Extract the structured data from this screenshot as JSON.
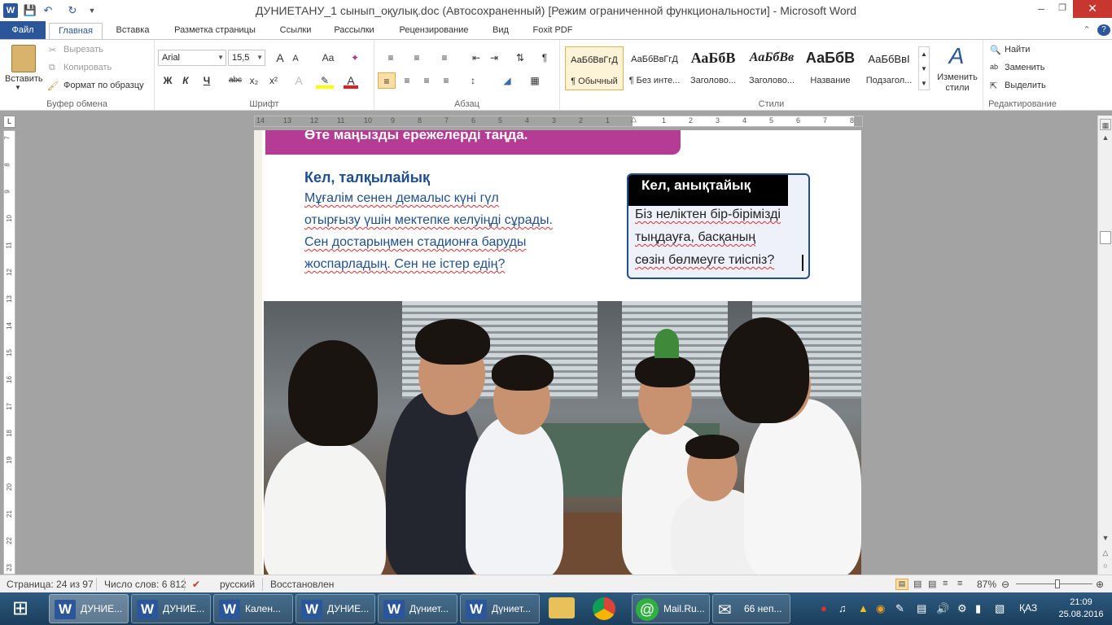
{
  "titlebar": {
    "title": "ДУНИЕТАНУ_1 сынып_оқулық.doc (Автосохраненный) [Режим ограниченной функциональности] - Microsoft Word",
    "help": "?"
  },
  "tabs": [
    "Файл",
    "Главная",
    "Вставка",
    "Разметка страницы",
    "Ссылки",
    "Рассылки",
    "Рецензирование",
    "Вид",
    "Foxit PDF"
  ],
  "ribbon": {
    "clipboard": {
      "paste": "Вставить",
      "cut": "Вырезать",
      "copy": "Копировать",
      "format_painter": "Формат по образцу",
      "label": "Буфер обмена"
    },
    "font": {
      "name": "Arial",
      "size": "15,5",
      "label": "Шрифт",
      "bold": "Ж",
      "italic": "К",
      "underline": "Ч",
      "strike": "abc",
      "sub": "x₂",
      "sup": "x²",
      "grow": "A",
      "shrink": "A",
      "case": "Aa"
    },
    "paragraph": {
      "label": "Абзац",
      "pilcrow": "¶"
    },
    "styles": {
      "label": "Стили",
      "items": [
        {
          "preview": "АаБбВвГгД",
          "name": "¶ Обычный"
        },
        {
          "preview": "АаБбВвГгД",
          "name": "¶ Без инте..."
        },
        {
          "preview": "АаБбВ",
          "name": "Заголово..."
        },
        {
          "preview": "АаБбВв",
          "name": "Заголово..."
        },
        {
          "preview": "АаБбВ",
          "name": "Название"
        },
        {
          "preview": "АаБбВвІ",
          "name": "Подзагол..."
        }
      ],
      "change": "Изменить стили"
    },
    "editing": {
      "label": "Редактирование",
      "find": "Найти",
      "replace": "Заменить",
      "select": "Выделить"
    }
  },
  "ruler": {
    "h_left": [
      "14",
      "13",
      "12",
      "11",
      "10",
      "9",
      "8",
      "7",
      "6",
      "5",
      "4",
      "3",
      "2",
      "1"
    ],
    "h_right": [
      "1",
      "2",
      "3",
      "4",
      "5",
      "6",
      "7",
      "8"
    ],
    "v": [
      "7",
      "8",
      "9",
      "10",
      "11",
      "12",
      "13",
      "14",
      "15",
      "16",
      "17",
      "18",
      "19",
      "20",
      "21",
      "22",
      "23"
    ]
  },
  "document": {
    "banner": "Өте маңызды ережелерді таңда.",
    "discuss_title": "Кел, талқылайық",
    "discuss_lines": [
      "Мұғалім сенен демалыс күні гүл",
      "отырғызу үшін мектепке келуіңді сұрады.",
      "Сен достарыңмен стадионға баруды",
      "жоспарладың. Сен не істер едің?"
    ],
    "ask_title": "Кел, анықтайық",
    "ask_lines": [
      "Біз неліктен бір-бірімізді",
      "тыңдауға, басқаның",
      "сөзін бөлмеуге тиіспіз?"
    ]
  },
  "statusbar": {
    "page": "Страница: 24 из 97",
    "words": "Число слов: 6 812",
    "lang": "русский",
    "state": "Восстановлен",
    "zoom": "87%",
    "zoom_fraction": 0.55
  },
  "taskbar": {
    "items": [
      {
        "icon": "W",
        "label": "ДУНИЕ..."
      },
      {
        "icon": "W",
        "label": "ДУНИЕ..."
      },
      {
        "icon": "W",
        "label": "Кален..."
      },
      {
        "icon": "W",
        "label": "ДУНИЕ..."
      },
      {
        "icon": "W",
        "label": "Дүниет..."
      },
      {
        "icon": "W",
        "label": "Дүниет..."
      }
    ],
    "pinned": [
      {
        "icon": "folder-icon",
        "label": ""
      },
      {
        "icon": "chrome-icon",
        "label": ""
      },
      {
        "icon": "mailru-icon",
        "label": "Mail.Ru..."
      },
      {
        "icon": "mail-icon",
        "label": "66 неп..."
      }
    ],
    "lang": "ҚАЗ",
    "time": "21:09",
    "date": "25.08.2016"
  }
}
